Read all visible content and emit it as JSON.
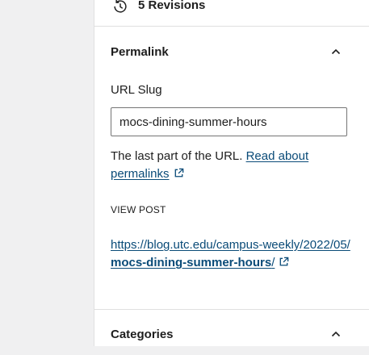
{
  "revisions": {
    "icon": "history-icon",
    "label": "5 Revisions"
  },
  "permalink_panel": {
    "title": "Permalink",
    "toggle_icon": "chevron-up-icon",
    "slug_label": "URL Slug",
    "slug_value": "mocs-dining-summer-hours",
    "help_text": "The last part of the URL. ",
    "help_link": "Read about permalinks",
    "view_post_label": "VIEW POST",
    "url_prefix": "https://blog.utc.edu/campus-weekly/2022/05/",
    "url_slug": "mocs-dining-summer-hours",
    "url_suffix": "/",
    "external_icon": "external-link-icon"
  },
  "categories_panel": {
    "title": "Categories",
    "toggle_icon": "chevron-up-icon"
  },
  "colors": {
    "link": "#0a4b78",
    "text": "#1e1e1e",
    "border": "#e0e0e0",
    "background": "#f0f0f1"
  }
}
